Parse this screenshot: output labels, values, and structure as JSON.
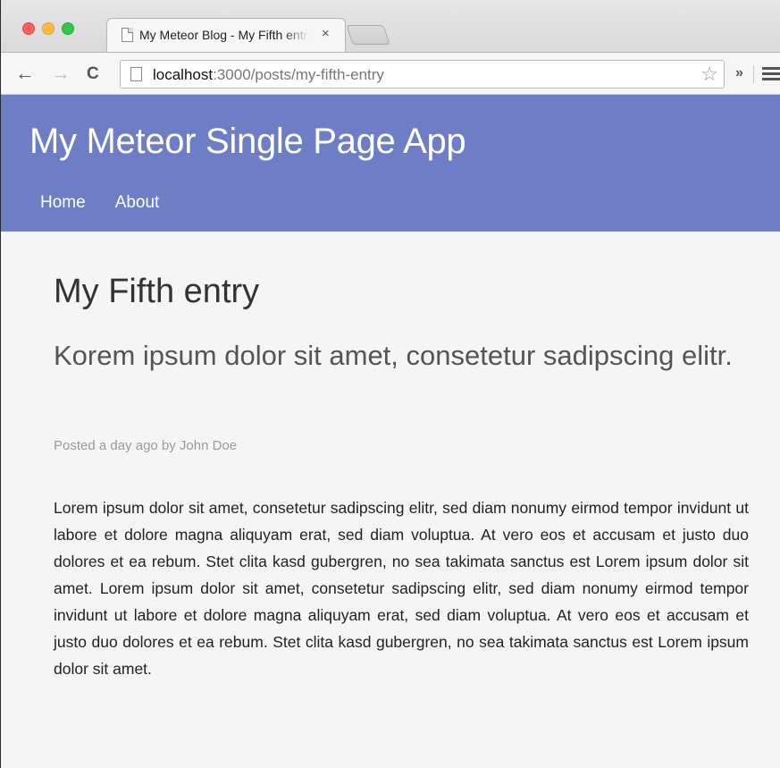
{
  "browser": {
    "tab_title": "My Meteor Blog - My Fifth entry",
    "tab_close": "×",
    "url_host": "localhost",
    "url_path": ":3000/posts/my-fifth-entry",
    "icons": {
      "back": "arrow-left",
      "forward": "arrow-right",
      "reload": "reload",
      "bookmark": "star",
      "extensions": "chevrons",
      "menu": "hamburger"
    }
  },
  "app": {
    "title": "My Meteor Single Page App",
    "nav": [
      "Home",
      "About"
    ],
    "header_color": "#6d7ec6"
  },
  "post": {
    "title": "My Fifth entry",
    "subtitle": "Korem ipsum dolor sit amet, consetetur sadipscing elitr.",
    "meta": "Posted a day ago by John Doe",
    "body": "Lorem ipsum dolor sit amet, consetetur sadipscing elitr, sed diam nonumy eirmod tempor invidunt ut labore et dolore magna aliquyam erat, sed diam voluptua. At vero eos et accusam et justo duo dolores et ea rebum. Stet clita kasd gubergren, no sea takimata sanctus est Lorem ipsum dolor sit amet. Lorem ipsum dolor sit amet, consetetur sadipscing elitr, sed diam nonumy eirmod tempor invidunt ut labore et dolore magna aliquyam erat, sed diam voluptua. At vero eos et accusam et justo duo dolores et ea rebum. Stet clita kasd gubergren, no sea takimata sanctus est Lorem ipsum dolor sit amet."
  }
}
